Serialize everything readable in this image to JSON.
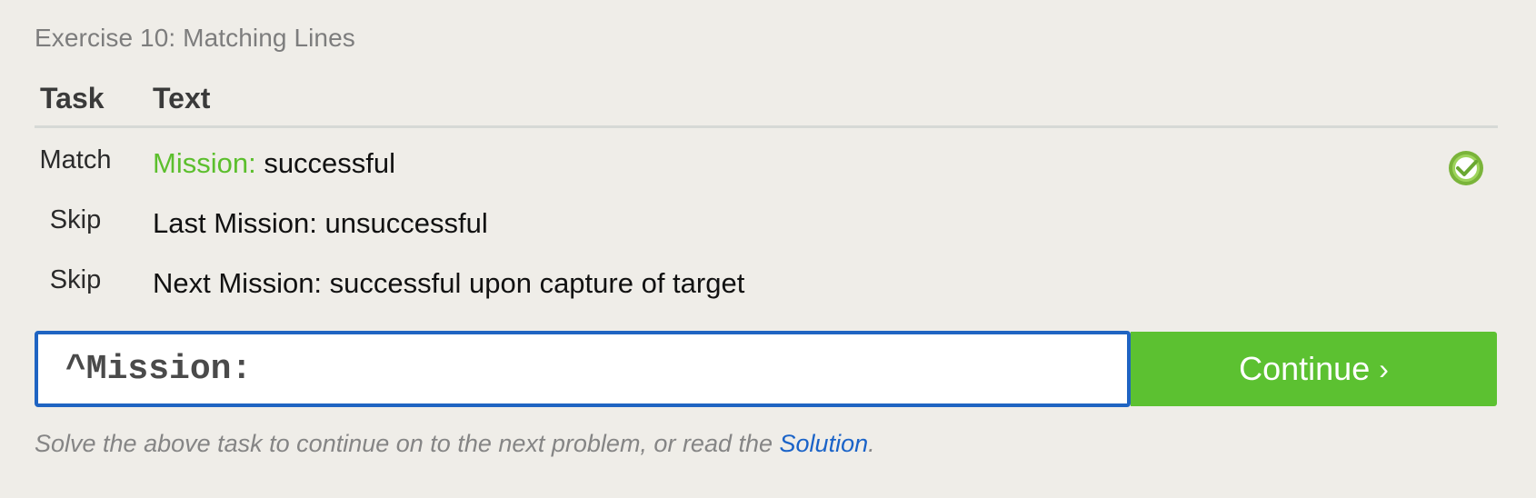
{
  "exercise": {
    "title": "Exercise 10: Matching Lines"
  },
  "table": {
    "headers": {
      "task": "Task",
      "text": "Text"
    },
    "rows": [
      {
        "task": "Match",
        "highlight": "Mission:",
        "rest": " successful",
        "status": "check-icon"
      },
      {
        "task": "Skip",
        "text": "Last Mission: unsuccessful"
      },
      {
        "task": "Skip",
        "text": "Next Mission: successful upon capture of target"
      }
    ]
  },
  "input": {
    "value": "^Mission:"
  },
  "continue_button": {
    "label": "Continue",
    "arrow": "›"
  },
  "hint": {
    "prefix": "Solve the above task to continue on to the next problem, or read the ",
    "link_text": "Solution",
    "suffix": "."
  },
  "colors": {
    "background": "#efede8",
    "match_highlight": "#5cbf2d",
    "continue_button": "#5cc131",
    "input_border": "#1f64c2",
    "link": "#1a63c8"
  }
}
